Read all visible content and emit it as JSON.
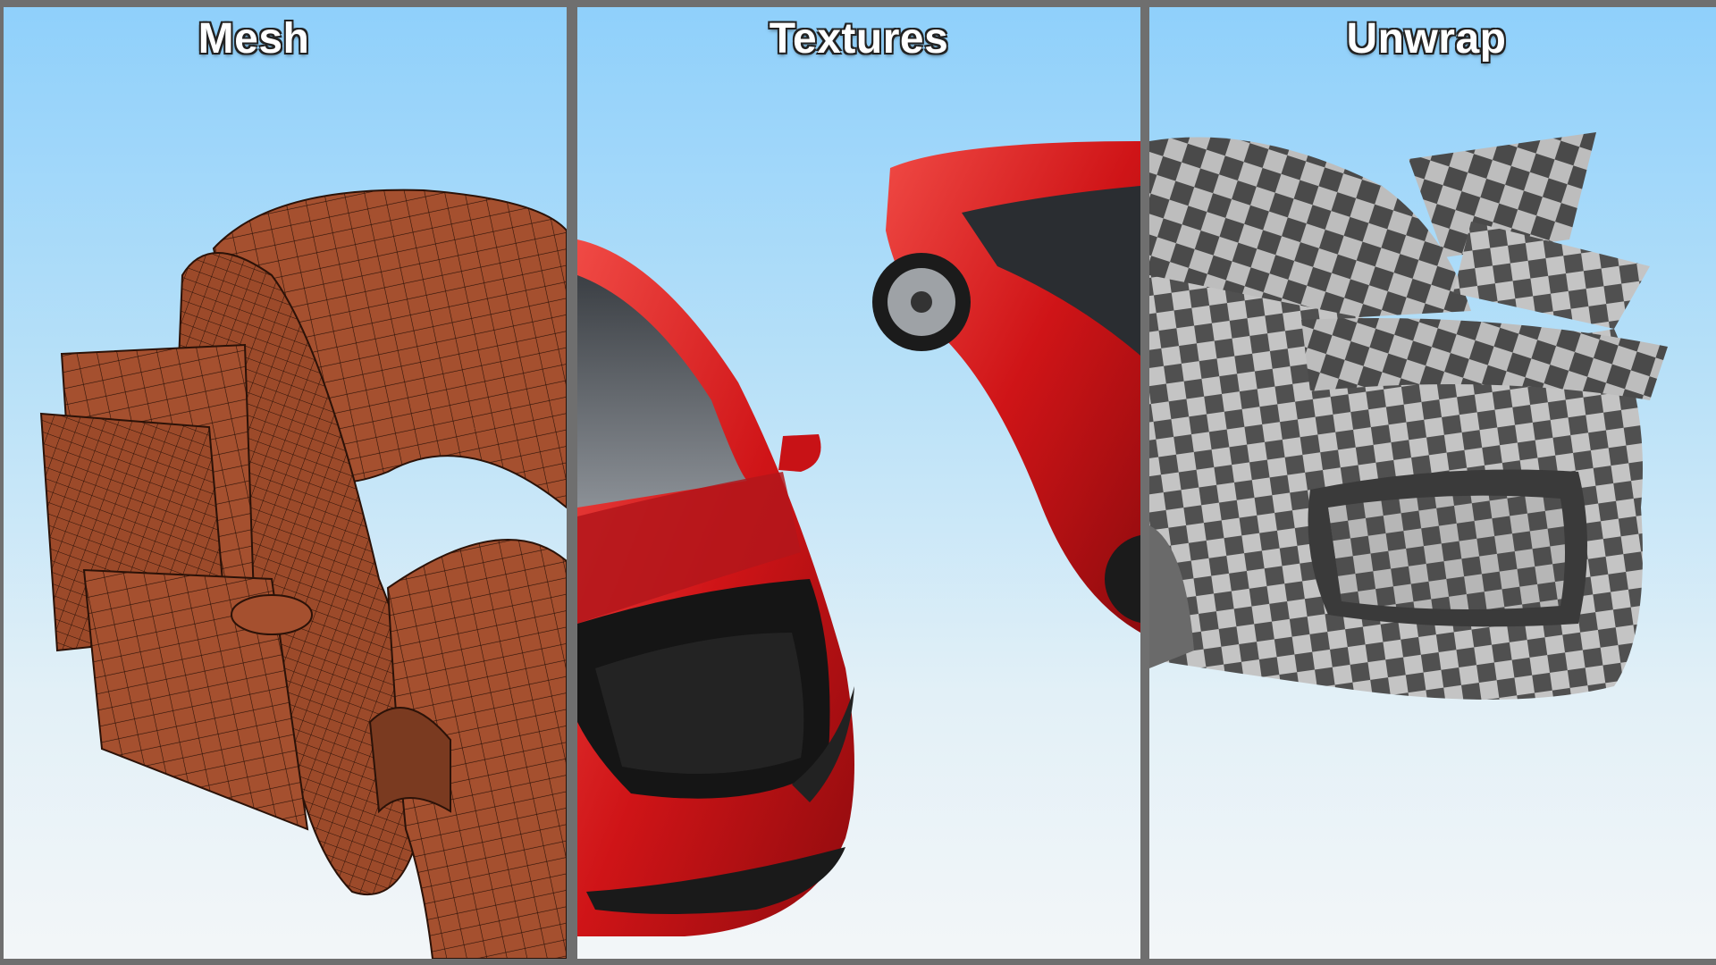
{
  "panels": [
    {
      "title": "Mesh"
    },
    {
      "title": "Textures"
    },
    {
      "title": "Unwrap"
    }
  ],
  "colors": {
    "divider": "#6f6f6f",
    "sky_top": "#8fd0fb",
    "sky_bottom": "#f3f6f8",
    "mesh_body": "#a5502f",
    "paint_red": "#d0161c",
    "checker_dark": "#4a4a4a",
    "checker_light": "#bdbdbd"
  }
}
